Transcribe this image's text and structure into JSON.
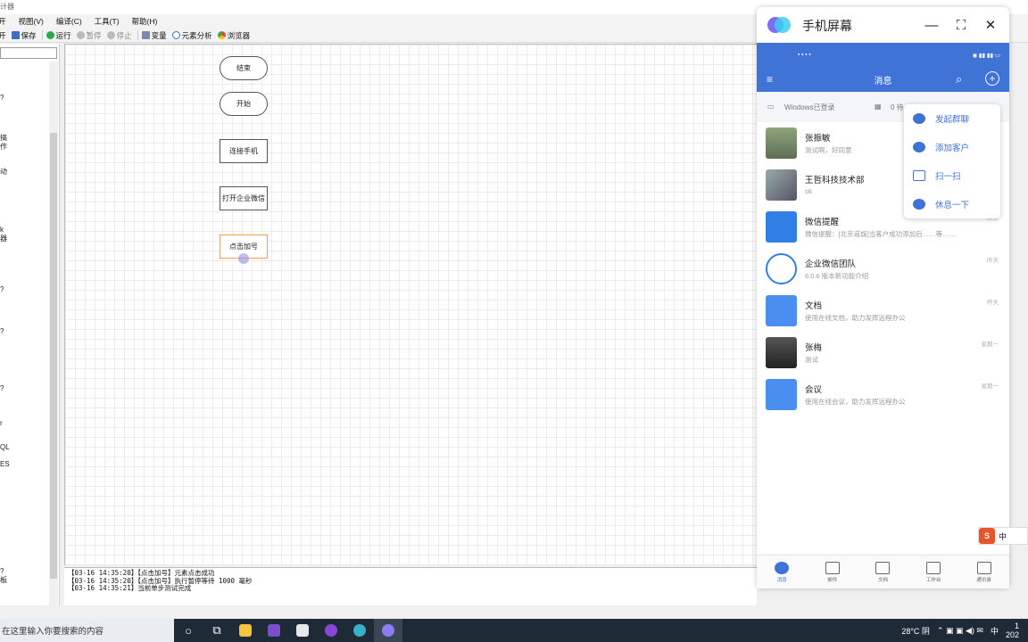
{
  "titlebar": {
    "title": "计器"
  },
  "menu": {
    "items": [
      "开",
      "视图(V)",
      "编译(C)",
      "工具(T)",
      "帮助(H)"
    ]
  },
  "toolbar": {
    "save": "保存",
    "run": "运行",
    "pause": "暂停",
    "stop": "停止",
    "variable": "变量",
    "element_analysis": "元素分析",
    "browser": "浏览器"
  },
  "left_panel": {
    "fragments": [
      "?",
      "",
      "搞",
      "作",
      "动",
      "k",
      "器",
      "?",
      "?",
      "?",
      "r",
      "QL",
      "ES",
      "?",
      "板",
      "?"
    ]
  },
  "canvas": {
    "nodes": [
      "结束",
      "开始",
      "连接手机",
      "打开企业微信",
      "点击加号"
    ]
  },
  "log": {
    "lines": [
      "【03-16 14:35:20】【点击加号】元素点击成功",
      "【03-16 14:35:20】【点击加号】执行暂停等待 1000 毫秒",
      "【03-16 14:35:21】当前单步测试完成"
    ]
  },
  "taskbar": {
    "search_placeholder": "在这里输入你要搜索的内容",
    "weather": "28°C 阴",
    "ime": "中",
    "clock_top": "1",
    "clock_bottom": "202"
  },
  "phone_window": {
    "title": "手机屏幕",
    "nav_title": "消息",
    "device_bar": "Windows已登录",
    "device_bar_right": "0 待",
    "popup_items": [
      "发起群聊",
      "添加客户",
      "扫一扫",
      "休息一下"
    ],
    "chats": [
      {
        "name": "张振敏",
        "msg": "测试啊，好同意",
        "time": ""
      },
      {
        "name": "王哲科技技术部",
        "msg": "ok",
        "time": ""
      },
      {
        "name": "微信提醒",
        "msg": "微信提醒：[北京道旗]当客户成功添加后……等……",
        "time": "昨天"
      },
      {
        "name": "企业微信团队",
        "msg": "6.0.6 版本新功能介绍",
        "time": "昨天"
      },
      {
        "name": "文档",
        "msg": "使用在线文档，助力发挥远程办公",
        "time": "昨天"
      },
      {
        "name": "张梅",
        "msg": "测试",
        "time": "星期一"
      },
      {
        "name": "会议",
        "msg": "使用在线会议，助力发挥远程办公",
        "time": "星期一"
      }
    ],
    "tabs": [
      "消息",
      "邮件",
      "文档",
      "工作台",
      "通讯录"
    ],
    "ime_badge": "中"
  },
  "colors": {
    "accent": "#3f74d6",
    "selected_node_border": "#f0a04b",
    "taskbar": "#1f2a37"
  }
}
